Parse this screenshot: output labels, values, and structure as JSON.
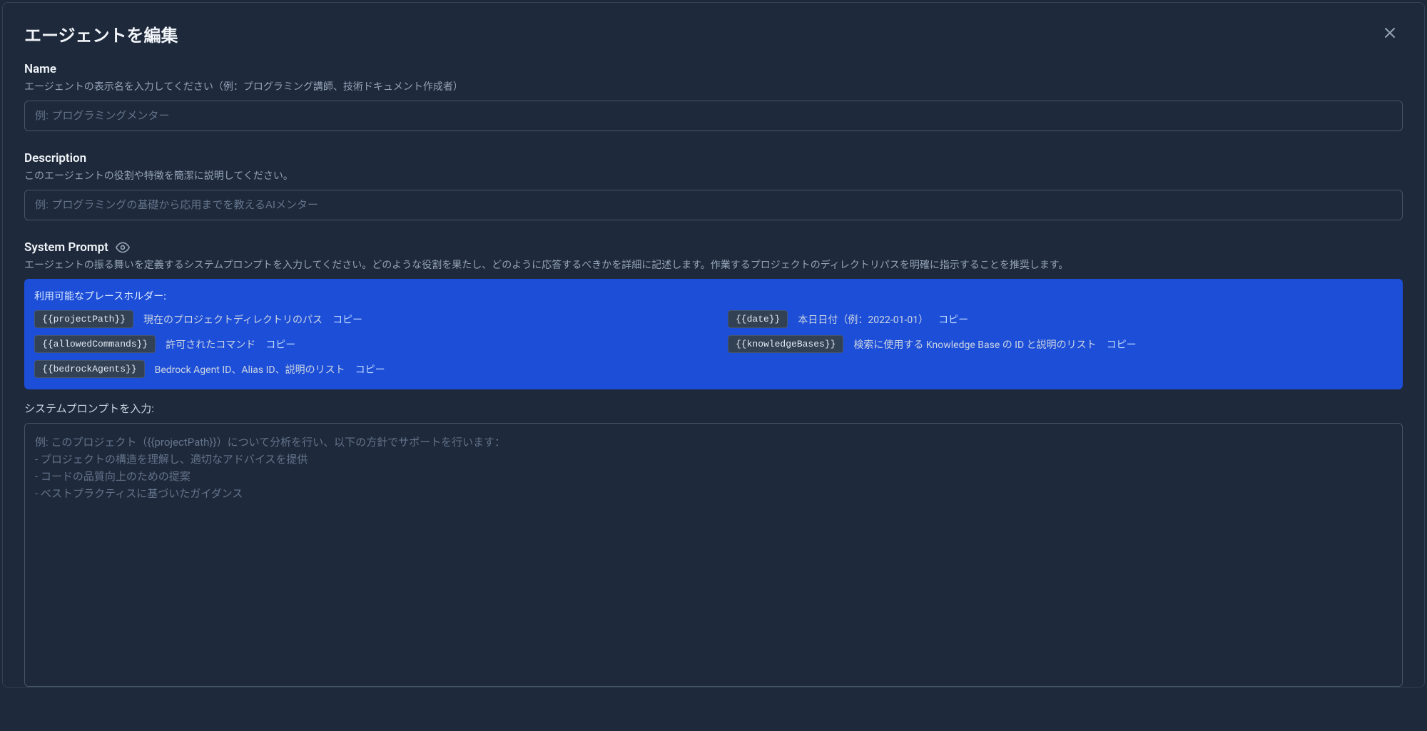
{
  "modal": {
    "title": "エージェントを編集"
  },
  "fields": {
    "name": {
      "label": "Name",
      "hint": "エージェントの表示名を入力してください（例：プログラミング講師、技術ドキュメント作成者）",
      "placeholder": "例: プログラミングメンター",
      "value": ""
    },
    "description": {
      "label": "Description",
      "hint": "このエージェントの役割や特徴を簡潔に説明してください。",
      "placeholder": "例: プログラミングの基礎から応用までを教えるAIメンター",
      "value": ""
    },
    "systemPrompt": {
      "label": "System Prompt",
      "hint": "エージェントの振る舞いを定義するシステムプロンプトを入力してください。どのような役割を果たし、どのように応答するべきかを詳細に記述します。作業するプロジェクトのディレクトリパスを明確に指示することを推奨します。",
      "inputLabel": "システムプロンプトを入力:",
      "placeholder": "例: このプロジェクト（{{projectPath}}）について分析を行い、以下の方針でサポートを行います：\n- プロジェクトの構造を理解し、適切なアドバイスを提供\n- コードの品質向上のための提案\n- ベストプラクティスに基づいたガイダンス",
      "value": ""
    }
  },
  "placeholders": {
    "title": "利用可能なプレースホルダー:",
    "copyLabel": "コピー",
    "items": [
      {
        "tag": "{{projectPath}}",
        "desc": "現在のプロジェクトディレクトリのパス"
      },
      {
        "tag": "{{date}}",
        "desc": "本日日付（例：2022-01-01）"
      },
      {
        "tag": "{{allowedCommands}}",
        "desc": "許可されたコマンド"
      },
      {
        "tag": "{{knowledgeBases}}",
        "desc": "検索に使用する Knowledge Base の ID と説明のリスト"
      },
      {
        "tag": "{{bedrockAgents}}",
        "desc": "Bedrock Agent ID、Alias ID、説明のリスト"
      }
    ]
  }
}
